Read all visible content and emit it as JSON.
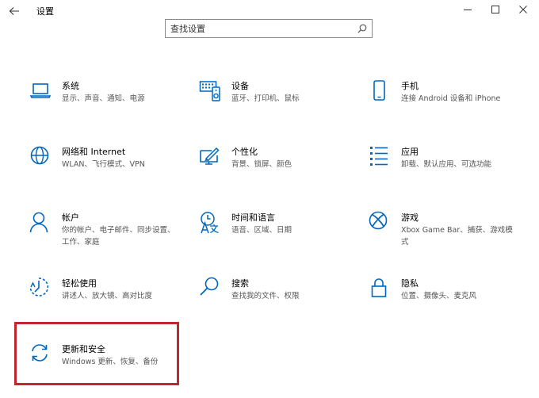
{
  "window": {
    "title": "设置",
    "back_icon": "back-arrow-icon",
    "minimize_icon": "minimize-icon",
    "maximize_icon": "maximize-icon",
    "close_icon": "close-icon"
  },
  "search": {
    "placeholder": "查找设置",
    "icon": "search-icon"
  },
  "accent_color": "#0067c0",
  "highlight_color": "#c0262d",
  "tiles": [
    {
      "title": "系统",
      "desc": "显示、声音、通知、电源",
      "icon": "laptop-icon"
    },
    {
      "title": "设备",
      "desc": "蓝牙、打印机、鼠标",
      "icon": "keyboard-speaker-icon"
    },
    {
      "title": "手机",
      "desc": "连接 Android 设备和 iPhone",
      "icon": "phone-icon"
    },
    {
      "title": "网络和 Internet",
      "desc": "WLAN、飞行模式、VPN",
      "icon": "globe-icon"
    },
    {
      "title": "个性化",
      "desc": "背景、锁屏、颜色",
      "icon": "paintbrush-icon"
    },
    {
      "title": "应用",
      "desc": "卸载、默认应用、可选功能",
      "icon": "apps-list-icon"
    },
    {
      "title": "帐户",
      "desc": "你的帐户、电子邮件、同步设置、工作、家庭",
      "icon": "person-icon"
    },
    {
      "title": "时间和语言",
      "desc": "语音、区域、日期",
      "icon": "time-language-icon"
    },
    {
      "title": "游戏",
      "desc": "Xbox Game Bar、捕获、游戏模式",
      "icon": "xbox-icon"
    },
    {
      "title": "轻松使用",
      "desc": "讲述人、放大镜、高对比度",
      "icon": "ease-of-access-icon"
    },
    {
      "title": "搜索",
      "desc": "查找我的文件、权限",
      "icon": "search-icon"
    },
    {
      "title": "隐私",
      "desc": "位置、摄像头、麦克风",
      "icon": "lock-icon"
    },
    {
      "title": "更新和安全",
      "desc": "Windows 更新、恢复、备份",
      "icon": "sync-icon"
    }
  ]
}
